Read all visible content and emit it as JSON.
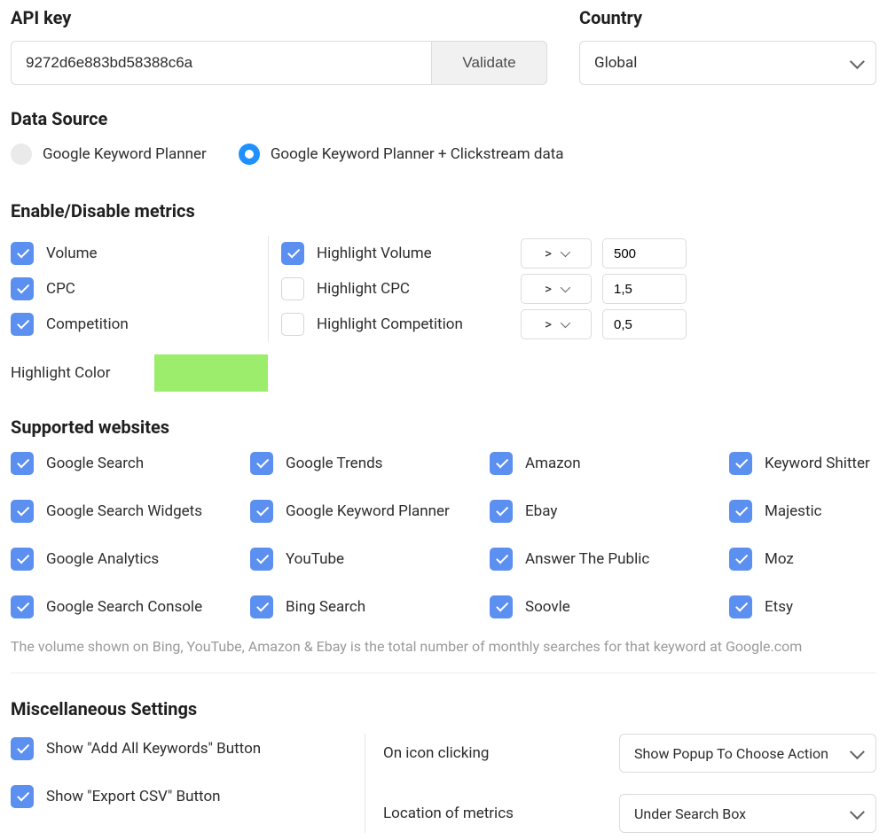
{
  "apiKey": {
    "label": "API key",
    "value": "9272d6e883bd58388c6a",
    "validateLabel": "Validate"
  },
  "country": {
    "label": "Country",
    "selected": "Global"
  },
  "dataSource": {
    "label": "Data Source",
    "options": [
      {
        "label": "Google Keyword Planner",
        "selected": false
      },
      {
        "label": "Google Keyword Planner + Clickstream data",
        "selected": true
      }
    ]
  },
  "metrics": {
    "label": "Enable/Disable metrics",
    "items": [
      {
        "name": "Volume",
        "enabled": true
      },
      {
        "name": "CPC",
        "enabled": true
      },
      {
        "name": "Competition",
        "enabled": true
      }
    ],
    "highlights": [
      {
        "name": "Highlight Volume",
        "enabled": true,
        "op": ">",
        "value": "500"
      },
      {
        "name": "Highlight CPC",
        "enabled": false,
        "op": ">",
        "value": "1,5"
      },
      {
        "name": "Highlight Competition",
        "enabled": false,
        "op": ">",
        "value": "0,5"
      }
    ],
    "highlightColor": {
      "label": "Highlight Color",
      "value": "#9ced6b"
    }
  },
  "sites": {
    "label": "Supported websites",
    "grid": [
      [
        "Google Search",
        "Google Trends",
        "Amazon",
        "Keyword Shitter"
      ],
      [
        "Google Search Widgets",
        "Google Keyword Planner",
        "Ebay",
        "Majestic"
      ],
      [
        "Google Analytics",
        "YouTube",
        "Answer The Public",
        "Moz"
      ],
      [
        "Google Search Console",
        "Bing Search",
        "Soovle",
        "Etsy"
      ]
    ],
    "note": "The volume shown on Bing, YouTube, Amazon & Ebay is the total number of monthly searches for that keyword at Google.com"
  },
  "misc": {
    "label": "Miscellaneous Settings",
    "leftChecks": [
      "Show \"Add All Keywords\" Button",
      "Show \"Export CSV\" Button"
    ],
    "rightSelects": [
      {
        "label": "On icon clicking",
        "value": "Show Popup To Choose Action"
      },
      {
        "label": "Location of metrics",
        "value": "Under Search Box"
      }
    ]
  }
}
